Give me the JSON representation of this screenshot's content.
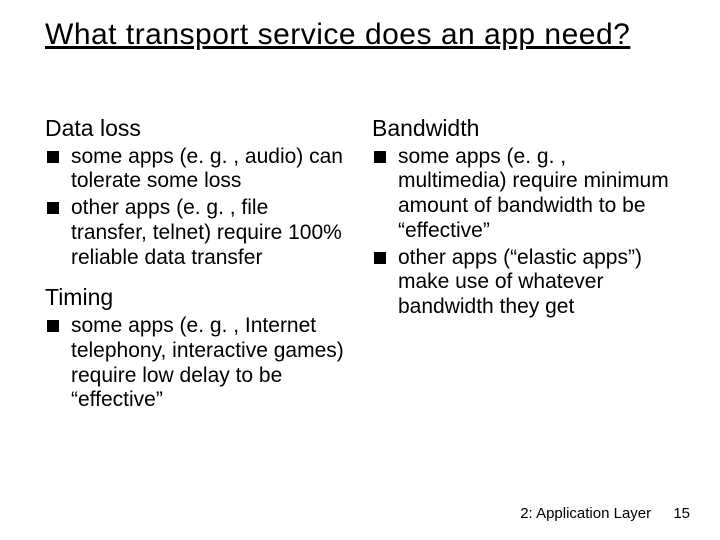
{
  "title": "What transport service does an app need?",
  "left": {
    "section1_heading": "Data loss",
    "section1_items": [
      "some apps (e. g. , audio) can tolerate some loss",
      "other apps (e. g. , file transfer, telnet) require 100% reliable data transfer"
    ],
    "section2_heading": "Timing",
    "section2_items": [
      "some apps (e. g. , Internet telephony, interactive games) require low delay to be “effective”"
    ]
  },
  "right": {
    "section1_heading": "Bandwidth",
    "section1_items": [
      "some apps (e. g. , multimedia) require minimum amount of bandwidth to be “effective”",
      "other apps (“elastic apps”) make use of whatever bandwidth they get"
    ]
  },
  "footer": {
    "chapter": "2: Application Layer",
    "page": "15"
  }
}
